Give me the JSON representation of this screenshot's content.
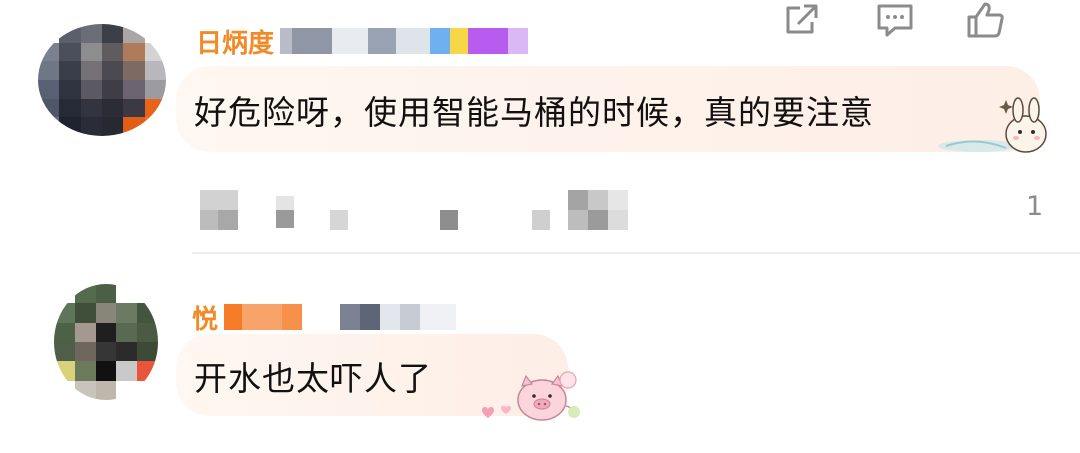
{
  "comments": [
    {
      "text": "好危险呀，使用智能马桶的时候，真的要注意",
      "username_visible": "日炳度",
      "like_count": "1",
      "sticker": "bunny-sticker"
    },
    {
      "text": "开水也太吓人了",
      "username_visible": "悦",
      "sticker": "pig-sticker"
    }
  ],
  "icons": {
    "share": "share-icon",
    "comment": "comment-icon",
    "like": "thumbs-up-icon"
  },
  "colors": {
    "username": "#f28a28",
    "icon_gray": "#8b8b8b",
    "bubble": "#fdeee6"
  }
}
